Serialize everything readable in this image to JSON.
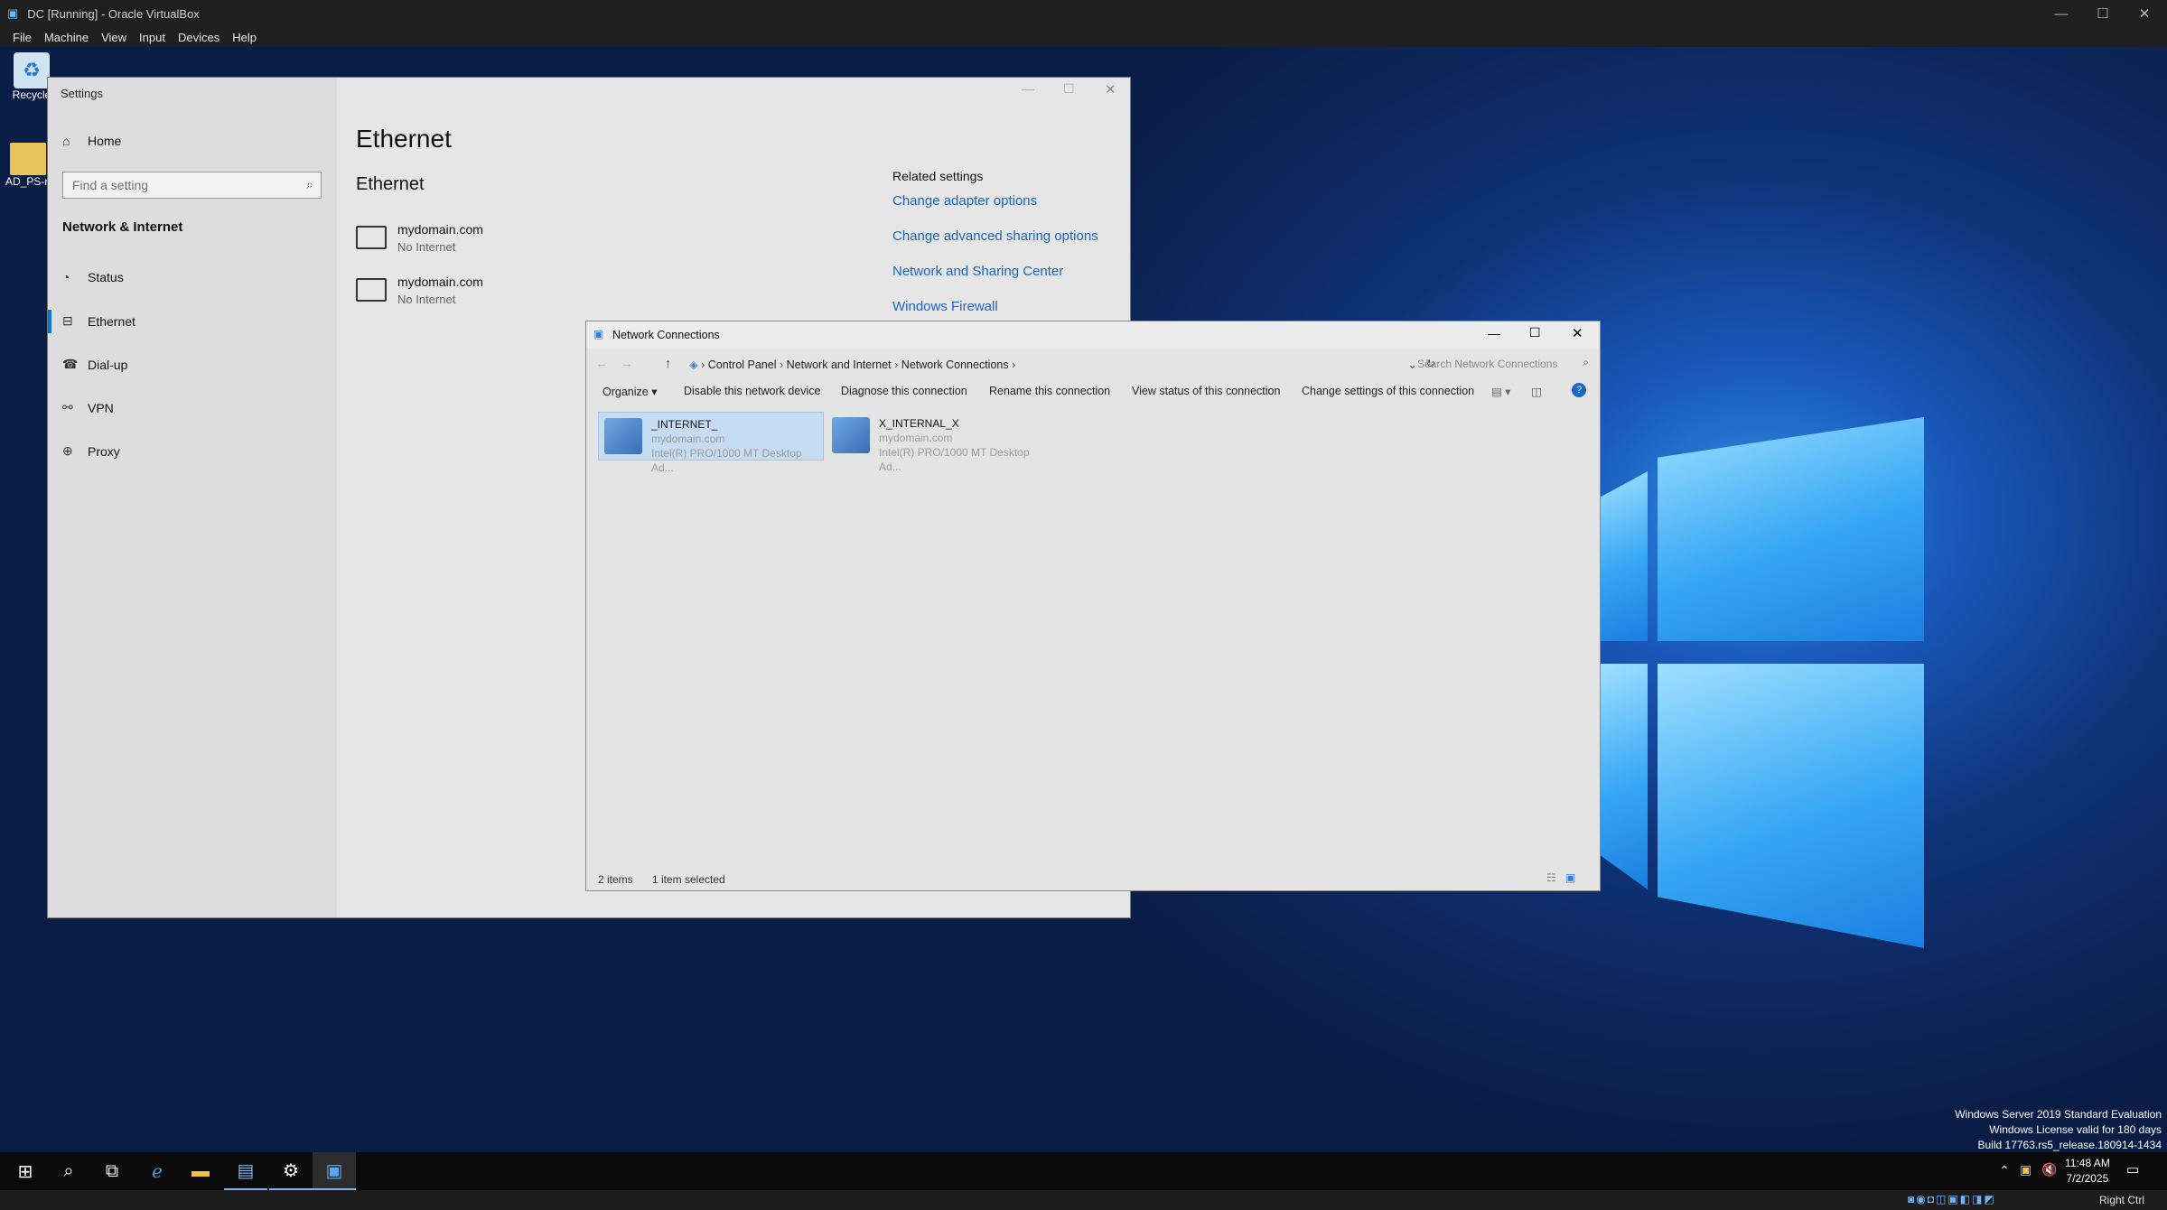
{
  "vbox": {
    "title": "DC [Running] - Oracle VirtualBox",
    "menu": [
      "File",
      "Machine",
      "View",
      "Input",
      "Devices",
      "Help"
    ],
    "host_key": "Right Ctrl"
  },
  "desktop": {
    "icons": [
      {
        "label": "Recycle",
        "icon": "recycle-bin-icon"
      },
      {
        "label": "AD_PS-n",
        "icon": "folder-icon"
      }
    ],
    "watermark": [
      "Windows Server 2019 Standard Evaluation",
      "Windows License valid for 180 days",
      "Build 17763.rs5_release.180914-1434"
    ]
  },
  "settings": {
    "title": "Settings",
    "home": "Home",
    "search_placeholder": "Find a setting",
    "section": "Network & Internet",
    "nav": [
      {
        "label": "Status",
        "icon": "status-icon"
      },
      {
        "label": "Ethernet",
        "icon": "ethernet-icon",
        "selected": true
      },
      {
        "label": "Dial-up",
        "icon": "dialup-icon"
      },
      {
        "label": "VPN",
        "icon": "vpn-icon"
      },
      {
        "label": "Proxy",
        "icon": "globe-icon"
      }
    ],
    "page_title": "Ethernet",
    "sub_title": "Ethernet",
    "adapters": [
      {
        "name": "mydomain.com",
        "status": "No Internet"
      },
      {
        "name": "mydomain.com",
        "status": "No Internet"
      }
    ],
    "related_title": "Related settings",
    "related_links": [
      "Change adapter options",
      "Change advanced sharing options",
      "Network and Sharing Center",
      "Windows Firewall"
    ]
  },
  "netconn": {
    "title": "Network Connections",
    "breadcrumb": [
      "Control Panel",
      "Network and Internet",
      "Network Connections"
    ],
    "search_placeholder": "Search Network Connections",
    "toolbar": [
      "Organize ▾",
      "Disable this network device",
      "Diagnose this connection",
      "Rename this connection",
      "View status of this connection",
      "Change settings of this connection"
    ],
    "items": [
      {
        "name": "_INTERNET_",
        "network": "mydomain.com",
        "device": "Intel(R) PRO/1000 MT Desktop Ad...",
        "selected": true
      },
      {
        "name": "X_INTERNAL_X",
        "network": "mydomain.com",
        "device": "Intel(R) PRO/1000 MT Desktop Ad..."
      }
    ],
    "status": {
      "count": "2 items",
      "selected": "1 item selected"
    }
  },
  "taskbar": {
    "time": "11:48 AM",
    "date": "7/2/2025"
  }
}
